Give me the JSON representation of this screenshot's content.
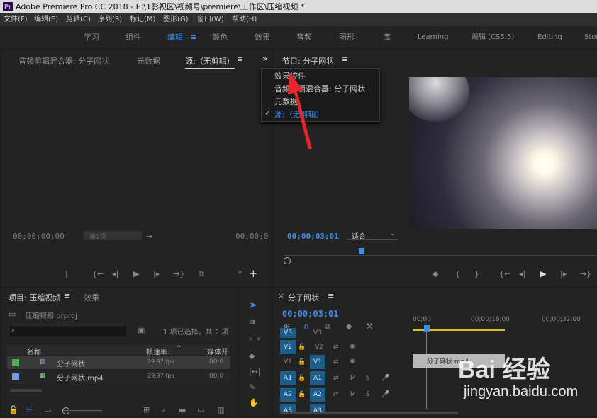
{
  "title_bar": {
    "app_icon": "Pr",
    "title": "Adobe Premiere Pro CC 2018 - E:\\1影视区\\视频号\\premiere\\工作区\\压缩视频 *"
  },
  "menu": [
    "文件(F)",
    "编辑(E)",
    "剪辑(C)",
    "序列(S)",
    "标记(M)",
    "图形(G)",
    "窗口(W)",
    "帮助(H)"
  ],
  "workspaces": {
    "items": [
      "学习",
      "组件",
      "编辑",
      "颜色",
      "效果",
      "音频",
      "图形",
      "库",
      "Learning",
      "编辑 (CS5.5)",
      "Editing",
      "Stor"
    ],
    "active": "编辑"
  },
  "source_panel": {
    "tabs": [
      "音频剪辑混合器: 分子网状",
      "元数据",
      "源:（无剪辑）"
    ],
    "timecode_left": "00;00;00;00",
    "timecode_right": "00;00;0",
    "page_label": "第1页"
  },
  "program_panel": {
    "title": "节目: 分子网状",
    "timecode": "00;00;03;01",
    "fit_option": "适合"
  },
  "dropdown_menu": {
    "items": [
      "效果控件",
      "音频剪辑混合器: 分子网状",
      "元数据",
      "源:（无剪辑）"
    ],
    "checked_index": 3
  },
  "project_panel": {
    "tab_project": "项目: 压缩视频",
    "tab_effects": "效果",
    "file": "压缩视频.prproj",
    "selection": "1 项已选择，共 2 项",
    "columns": [
      "名称",
      "帧速率",
      "媒体开"
    ],
    "rows": [
      {
        "name": "分子网状",
        "fps": "29.97 fps",
        "start": "00:0",
        "color": "#4caf50"
      },
      {
        "name": "分子网状.mp4",
        "fps": "29.97 fps",
        "start": "00:0",
        "color": "#6f9de0"
      }
    ]
  },
  "timeline": {
    "title": "分子网状",
    "timecode": "00;00;03;01",
    "ruler": [
      "00;00",
      "00;00;16;00",
      "00;00;32;00"
    ],
    "tracks": [
      "V3",
      "V2",
      "V1",
      "A1",
      "A2",
      "A3"
    ],
    "clip_label": "分子网状.mp4"
  },
  "watermark": {
    "brand": "Bai 经验",
    "url": "jingyan.baidu.com"
  }
}
